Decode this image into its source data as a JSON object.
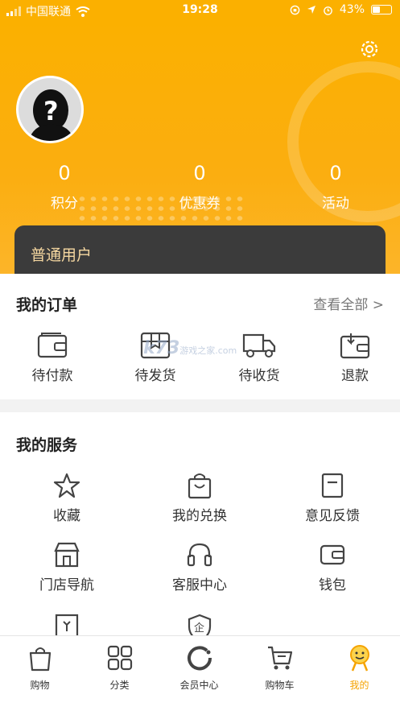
{
  "status_bar": {
    "carrier": "中国联通",
    "time": "19:28",
    "battery": "43%"
  },
  "profile": {
    "stats": [
      {
        "value": "0",
        "label": "积分"
      },
      {
        "value": "0",
        "label": "优惠券"
      },
      {
        "value": "0",
        "label": "活动"
      }
    ],
    "member_level": "普通用户"
  },
  "orders": {
    "title": "我的订单",
    "view_all": "查看全部 >",
    "items": [
      {
        "label": "待付款",
        "icon": "wallet-icon"
      },
      {
        "label": "待发货",
        "icon": "package-icon"
      },
      {
        "label": "待收货",
        "icon": "truck-icon"
      },
      {
        "label": "退款",
        "icon": "refund-icon"
      }
    ]
  },
  "watermark": {
    "text": "k73",
    "sub": "游戏之家",
    "domain": ".com"
  },
  "services": {
    "title": "我的服务",
    "items": [
      {
        "label": "收藏",
        "icon": "star-icon"
      },
      {
        "label": "我的兑换",
        "icon": "shopping-bag-icon"
      },
      {
        "label": "意见反馈",
        "icon": "feedback-icon"
      },
      {
        "label": "门店导航",
        "icon": "store-icon"
      },
      {
        "label": "客服中心",
        "icon": "headset-icon"
      },
      {
        "label": "钱包",
        "icon": "wallet-icon"
      }
    ]
  },
  "tabbar": {
    "items": [
      {
        "label": "购物",
        "icon": "bag-icon"
      },
      {
        "label": "分类",
        "icon": "grid-icon"
      },
      {
        "label": "会员中心",
        "icon": "member-icon"
      },
      {
        "label": "购物车",
        "icon": "cart-icon"
      },
      {
        "label": "我的",
        "icon": "profile-icon",
        "active": true
      }
    ]
  },
  "colors": {
    "brand": "#fbb000",
    "card_dark": "#3b3b3b",
    "card_text": "#f5d7a0",
    "active_tab": "#f5a300"
  }
}
